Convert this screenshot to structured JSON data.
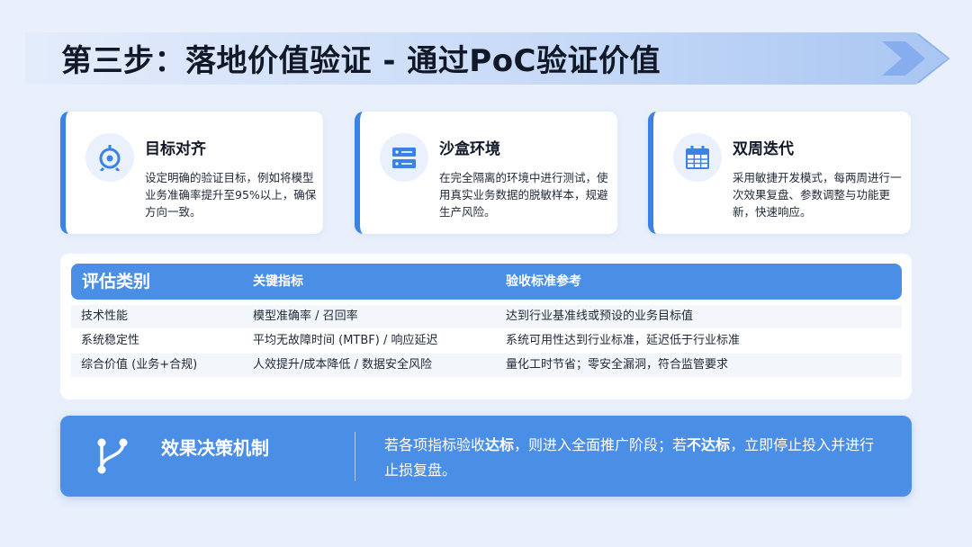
{
  "page": {
    "title": "第三步：落地价值验证 - 通过PoC验证价值"
  },
  "cards": [
    {
      "title": "目标对齐",
      "desc": "设定明确的验证目标，例如将模型业务准确率提升至95%以上，确保方向一致。",
      "icon": "target-icon"
    },
    {
      "title": "沙盒环境",
      "desc": "在完全隔离的环境中进行测试，使用真实业务数据的脱敏样本，规避生产风险。",
      "icon": "server-icon"
    },
    {
      "title": "双周迭代",
      "desc": "采用敏捷开发模式，每两周进行一次效果复盘、参数调整与功能更新，快速响应。",
      "icon": "calendar-icon"
    }
  ],
  "table": {
    "headers": [
      "评估类别",
      "关键指标",
      "验收标准参考"
    ],
    "rows": [
      [
        "技术性能",
        "模型准确率 / 召回率",
        "达到行业基准线或预设的业务目标值"
      ],
      [
        "系统稳定性",
        "平均无故障时间 (MTBF) / 响应延迟",
        "系统可用性达到行业标准，延迟低于行业标准"
      ],
      [
        "综合价值 (业务+合规)",
        "人效提升/成本降低 / 数据安全风险",
        "量化工时节省；零安全漏洞，符合监管要求"
      ]
    ]
  },
  "decision": {
    "title": "效果决策机制",
    "text_1": "若各项指标验收",
    "bold_1": "达标",
    "text_2": "，则进入全面推广阶段；若",
    "bold_2": "不达标",
    "text_3": "，立即停止投入并进行止损复盘。",
    "icon": "branch-icon"
  },
  "colors": {
    "accent": "#4a8ee6",
    "accent_dark": "#3b82e6",
    "background": "#e9f0fc",
    "title_band": "#c9dbf8"
  }
}
